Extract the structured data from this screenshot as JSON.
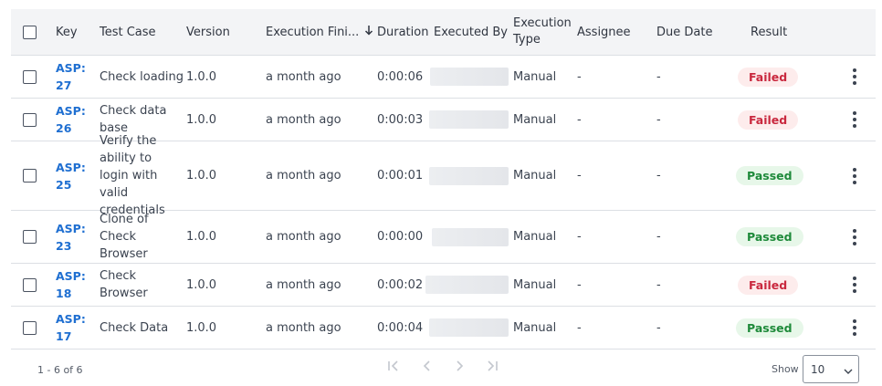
{
  "header": {
    "key": "Key",
    "test_case": "Test Case",
    "version": "Version",
    "execution_finished": "Execution Fini...",
    "duration": "Duration",
    "executed_by": "Executed By",
    "execution_type": "Execution Type",
    "assignee": "Assignee",
    "due_date": "Due Date",
    "result": "Result"
  },
  "rows": [
    {
      "key": "ASP:27",
      "test_case": "Check loading",
      "version": "1.0.0",
      "finished": "a month ago",
      "duration": "0:00:06",
      "type": "Manual",
      "assignee": "-",
      "due": "-",
      "result": "Failed"
    },
    {
      "key": "ASP:26",
      "test_case": "Check data base",
      "version": "1.0.0",
      "finished": "a month ago",
      "duration": "0:00:03",
      "type": "Manual",
      "assignee": "-",
      "due": "-",
      "result": "Failed"
    },
    {
      "key": "ASP:25",
      "test_case": "Verify the ability to login with valid credentials",
      "version": "1.0.0",
      "finished": "a month ago",
      "duration": "0:00:01",
      "type": "Manual",
      "assignee": "-",
      "due": "-",
      "result": "Passed"
    },
    {
      "key": "ASP:23",
      "test_case": "Clone of Check Browser",
      "version": "1.0.0",
      "finished": "a month ago",
      "duration": "0:00:00",
      "type": "Manual",
      "assignee": "-",
      "due": "-",
      "result": "Passed"
    },
    {
      "key": "ASP:18",
      "test_case": "Check Browser",
      "version": "1.0.0",
      "finished": "a month ago",
      "duration": "0:00:02",
      "type": "Manual",
      "assignee": "-",
      "due": "-",
      "result": "Failed"
    },
    {
      "key": "ASP:17",
      "test_case": "Check Data",
      "version": "1.0.0",
      "finished": "a month ago",
      "duration": "0:00:04",
      "type": "Manual",
      "assignee": "-",
      "due": "-",
      "result": "Passed"
    }
  ],
  "footer": {
    "range": "1 - 6 of 6",
    "show_label": "Show",
    "page_size": "10"
  },
  "colors": {
    "failed": "#c9283e",
    "passed": "#1e8a3a",
    "link": "#1f6fd1"
  }
}
